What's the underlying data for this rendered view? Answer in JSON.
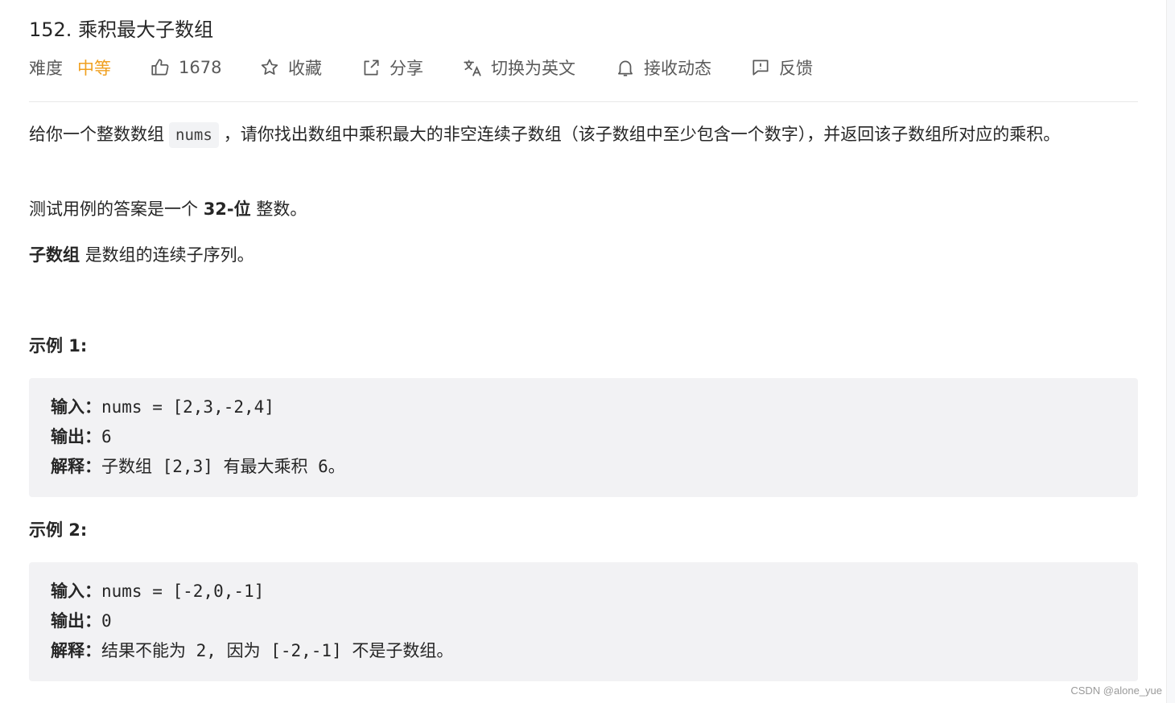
{
  "problem": {
    "title": "152. 乘积最大子数组"
  },
  "meta": {
    "difficulty_label": "难度",
    "difficulty_value": "中等",
    "likes": "1678",
    "favorite_label": "收藏",
    "share_label": "分享",
    "translate_label": "切换为英文",
    "notify_label": "接收动态",
    "feedback_label": "反馈"
  },
  "description": {
    "p1_before": "给你一个整数数组",
    "p1_code": "nums",
    "p1_after": "，请你找出数组中乘积最大的非空连续子数组（该子数组中至少包含一个数字），并返回该子数组所对应的乘积。",
    "p2_before": "测试用例的答案是一个",
    "p2_bold": "32-位",
    "p2_after": "整数。",
    "p3_bold": "子数组",
    "p3_after": "是数组的连续子序列。"
  },
  "examples": [
    {
      "title": "示例 1:",
      "input_label": "输入：",
      "input_value": "nums = [2,3,-2,4]",
      "output_label": "输出：",
      "output_value": "6",
      "explain_label": "解释：",
      "explain_value": "子数组 [2,3] 有最大乘积 6。"
    },
    {
      "title": "示例 2:",
      "input_label": "输入：",
      "input_value": "nums = [-2,0,-1]",
      "output_label": "输出：",
      "output_value": "0",
      "explain_label": "解释：",
      "explain_value": "结果不能为 2, 因为 [-2,-1] 不是子数组。"
    }
  ],
  "watermark": "CSDN @alone_yue",
  "colors": {
    "difficulty_medium": "#f0a020",
    "code_bg": "#f2f2f4",
    "text": "#262626"
  },
  "icons": [
    "thumbs-up-icon",
    "star-icon",
    "share-icon",
    "translate-icon",
    "bell-icon",
    "feedback-icon"
  ]
}
